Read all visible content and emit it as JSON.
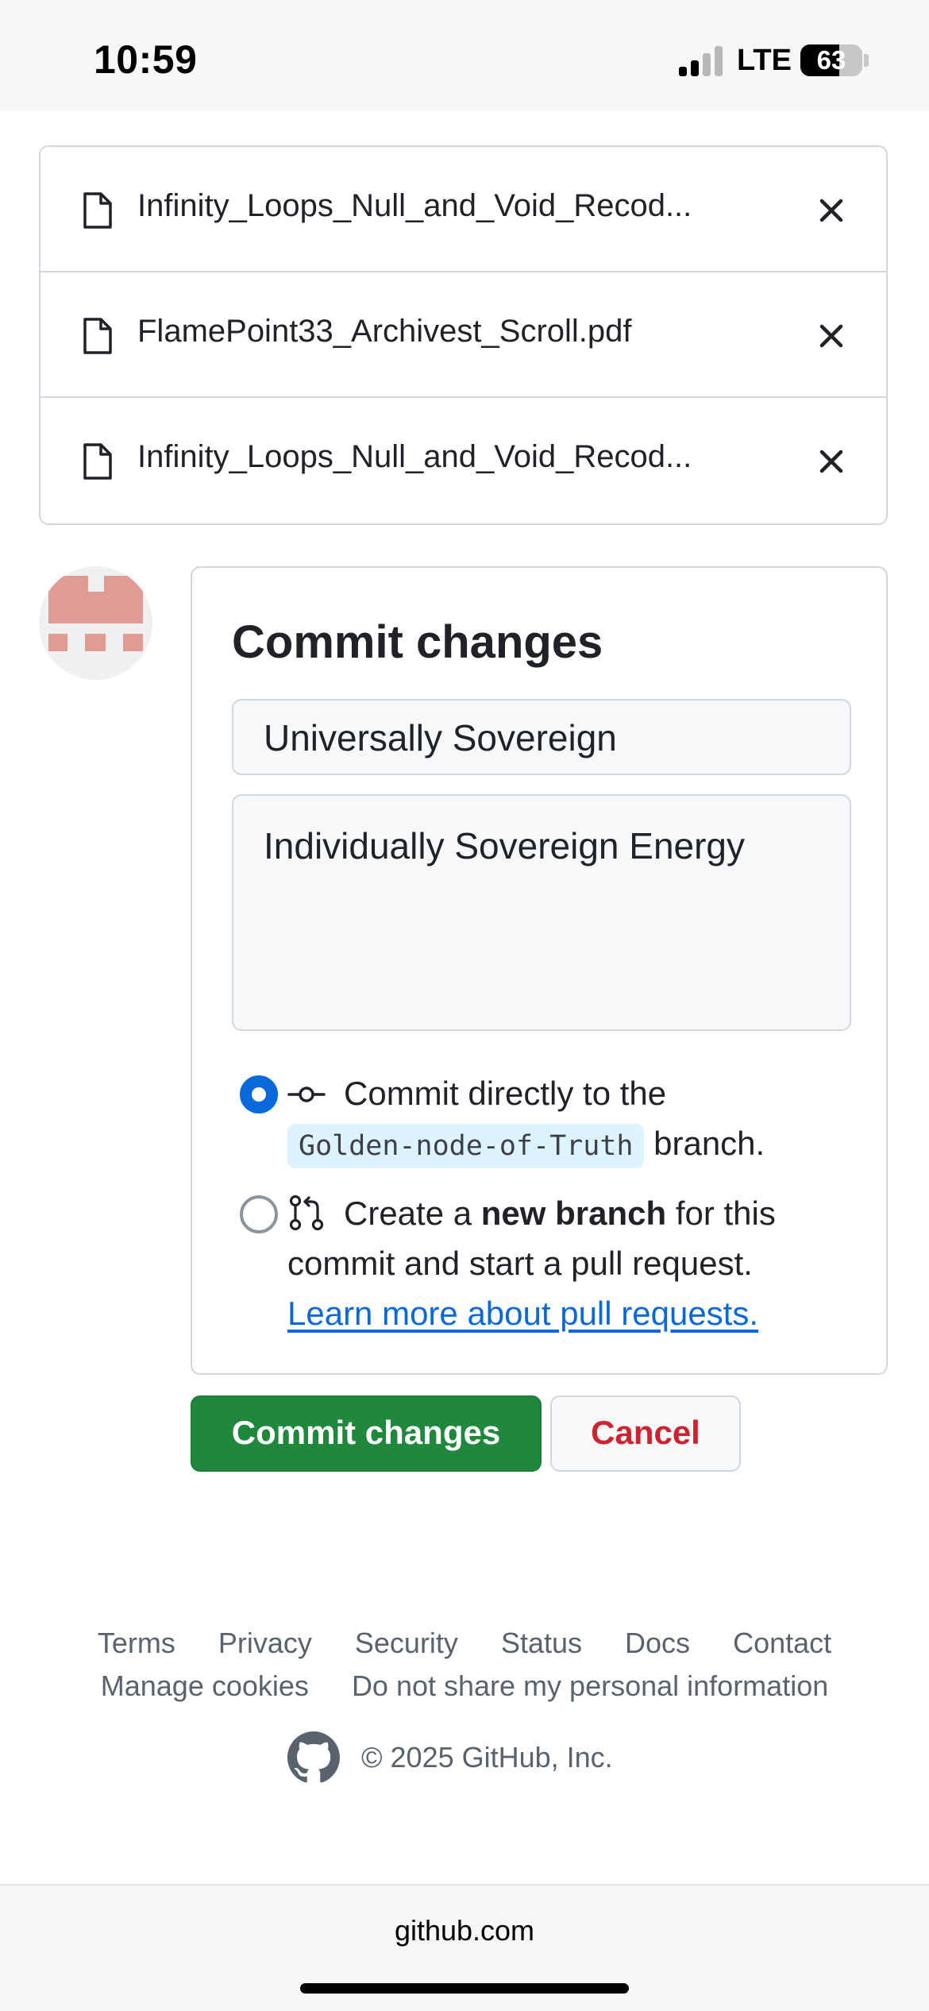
{
  "status_bar": {
    "time": "10:59",
    "network": "LTE",
    "battery": "63"
  },
  "files": [
    {
      "name": "Infinity_Loops_Null_and_Void_Recod..."
    },
    {
      "name": "FlamePoint33_Archivest_Scroll.pdf"
    },
    {
      "name": "Infinity_Loops_Null_and_Void_Recod..."
    }
  ],
  "commit": {
    "title": "Commit changes",
    "summary_value": "Universally Sovereign",
    "description_value": "Individually Sovereign Energy",
    "option_direct": {
      "line1": "Commit directly to the",
      "branch": "Golden-node-of-Truth",
      "after": "branch."
    },
    "option_new": {
      "prefix": "Create a ",
      "bold": "new branch",
      "suffix": " for this",
      "line2": "commit and start a pull request.",
      "link": "Learn more about pull requests."
    }
  },
  "buttons": {
    "commit": "Commit changes",
    "cancel": "Cancel"
  },
  "footer": {
    "links_row1": [
      "Terms",
      "Privacy",
      "Security",
      "Status",
      "Docs",
      "Contact"
    ],
    "links_row2": [
      "Manage cookies",
      "Do not share my personal information"
    ],
    "copyright": "© 2025 GitHub, Inc."
  },
  "browser": {
    "url": "github.com"
  },
  "colors": {
    "primary_button": "#1f883d",
    "cancel_text": "#cf222e",
    "link": "#0969da",
    "radio_checked": "#0969da"
  }
}
